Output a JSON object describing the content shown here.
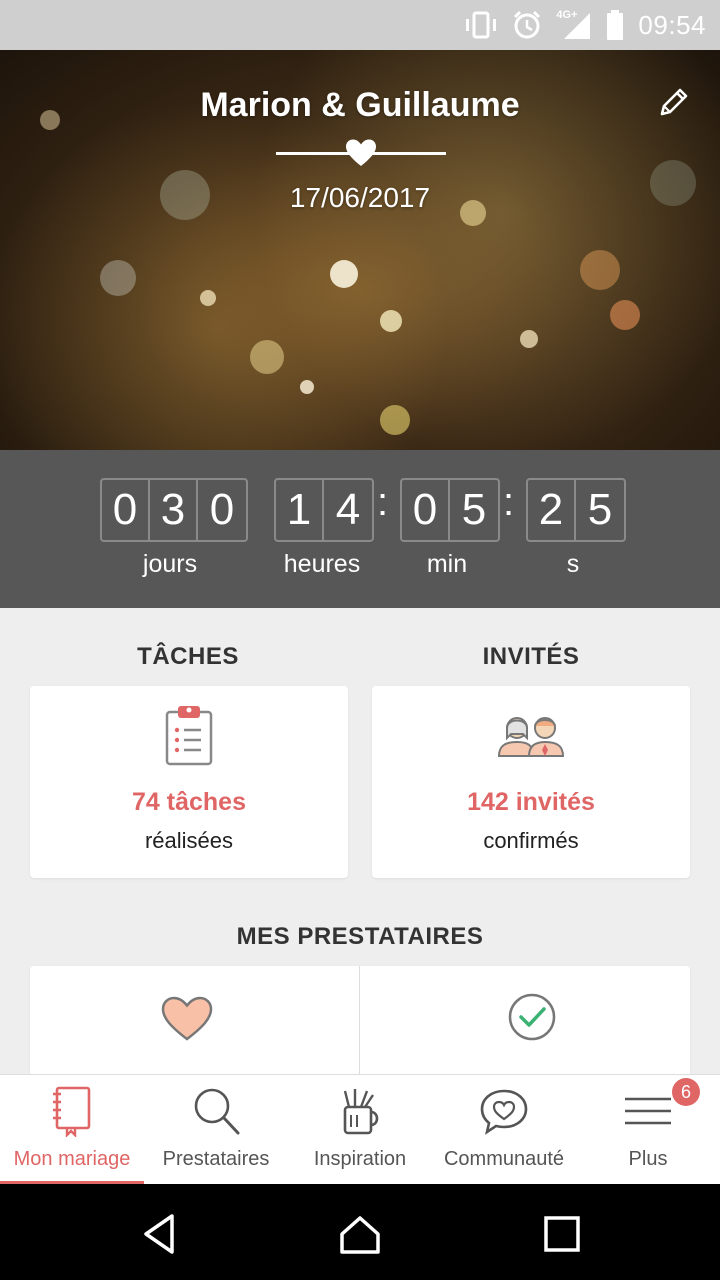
{
  "status_bar": {
    "time": "09:54",
    "network": "4G+",
    "icons": [
      "vibrate-icon",
      "alarm-icon",
      "signal-icon",
      "battery-icon"
    ]
  },
  "hero": {
    "couple_names": "Marion & Guillaume",
    "wedding_date": "17/06/2017",
    "edit_icon": "pencil-icon"
  },
  "countdown": {
    "days": [
      "0",
      "3",
      "0"
    ],
    "hours": [
      "1",
      "4"
    ],
    "minutes": [
      "0",
      "5"
    ],
    "seconds": [
      "2",
      "5"
    ],
    "labels": {
      "days": "jours",
      "hours": "heures",
      "minutes": "min",
      "seconds": "s"
    }
  },
  "tasks": {
    "title": "TÂCHES",
    "count": "74 tâches",
    "subtitle": "réalisées",
    "icon": "clipboard-checklist-icon"
  },
  "guests": {
    "title": "INVITÉS",
    "count": "142 invités",
    "subtitle": "confirmés",
    "icon": "couple-guests-icon"
  },
  "vendors": {
    "title": "MES PRESTATAIRES",
    "cards": [
      {
        "icon": "heart-icon"
      },
      {
        "icon": "check-circle-icon"
      }
    ]
  },
  "bottom_nav": {
    "items": [
      {
        "label": "Mon mariage",
        "icon": "notebook-icon",
        "active": true
      },
      {
        "label": "Prestataires",
        "icon": "search-icon",
        "active": false
      },
      {
        "label": "Inspiration",
        "icon": "pencil-cup-icon",
        "active": false
      },
      {
        "label": "Communauté",
        "icon": "chat-heart-icon",
        "active": false
      },
      {
        "label": "Plus",
        "icon": "menu-icon",
        "active": false
      }
    ],
    "badge_count": "6"
  },
  "system_nav": {
    "icons": [
      "back-icon",
      "home-icon",
      "recents-icon"
    ]
  },
  "colors": {
    "accent": "#e06666",
    "countdown_bg": "#575757",
    "page_bg": "#eeeeee",
    "status_bar": "#cfcfcf"
  }
}
